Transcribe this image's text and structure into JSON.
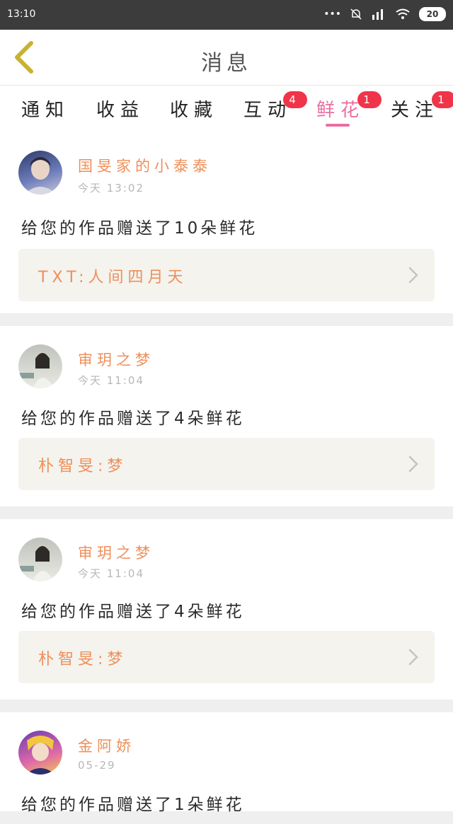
{
  "status_bar": {
    "time": "13:10",
    "dots": "•••",
    "battery": "20"
  },
  "header": {
    "title": "消息"
  },
  "tabs": [
    {
      "label": "通知",
      "badge": ""
    },
    {
      "label": "收益",
      "badge": ""
    },
    {
      "label": "收藏",
      "badge": ""
    },
    {
      "label": "互动",
      "badge": "4"
    },
    {
      "label": "鲜花",
      "badge": "1"
    },
    {
      "label": "关注",
      "badge": "1"
    }
  ],
  "colors": {
    "accent": "#e8709f",
    "orange": "#ee8f5a",
    "badge": "#f0344a"
  },
  "messages": [
    {
      "name": "国旻家的小泰泰",
      "time": "今天 13:02",
      "text": "给您的作品赠送了10朵鲜花",
      "work": "TXT:人间四月天"
    },
    {
      "name": "审玥之梦",
      "time": "今天 11:04",
      "text": "给您的作品赠送了4朵鲜花",
      "work": "朴智旻:梦"
    },
    {
      "name": "审玥之梦",
      "time": "今天 11:04",
      "text": "给您的作品赠送了4朵鲜花",
      "work": "朴智旻:梦"
    },
    {
      "name": "金阿娇",
      "time": "05-29",
      "text": "给您的作品赠送了1朵鲜花",
      "work": ""
    }
  ]
}
